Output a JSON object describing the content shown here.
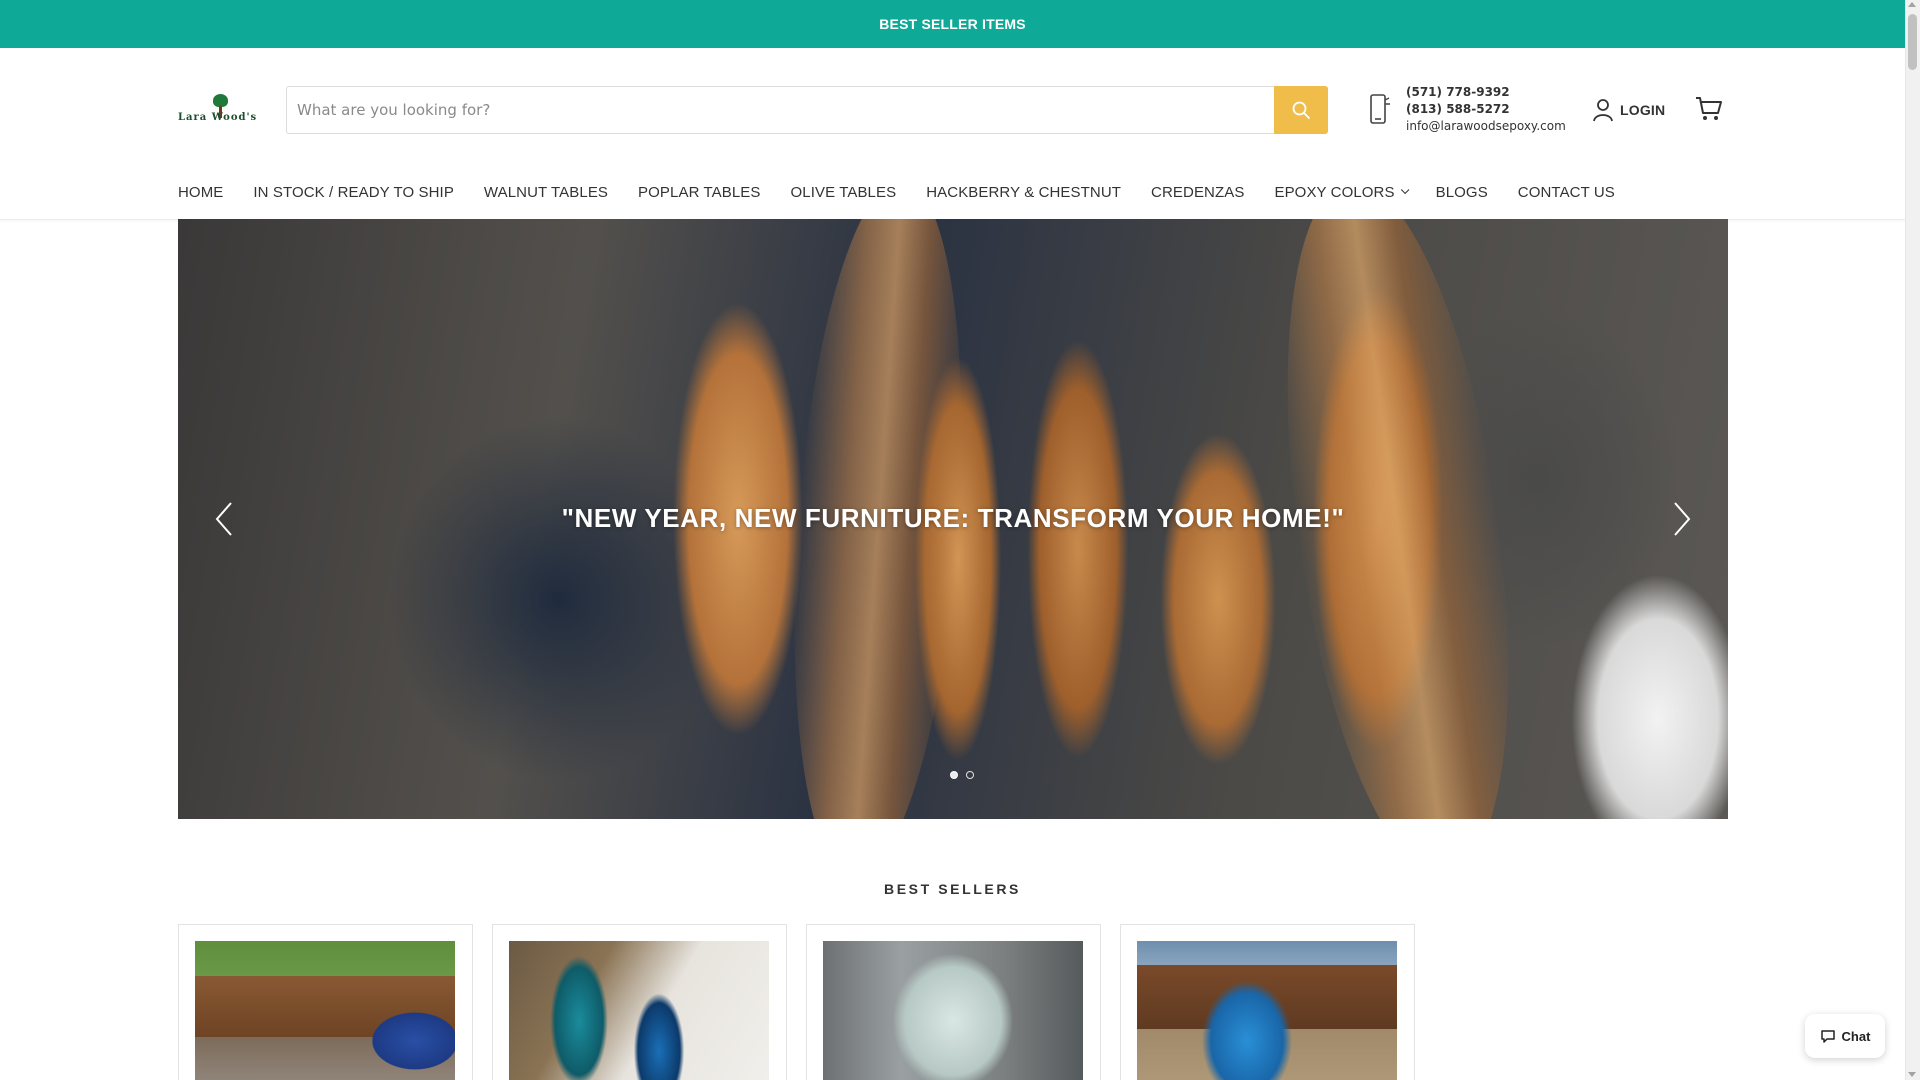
{
  "announcement": {
    "text": "BEST SELLER ITEMS"
  },
  "logo": {
    "brand": "Lara Wood's"
  },
  "search": {
    "placeholder": "What are you looking for?"
  },
  "contact": {
    "phone_1": "(571) 778-9392",
    "phone_2": "(813) 588-5272",
    "email": "info@larawoodsepoxy.com"
  },
  "account": {
    "login_label": "LOGIN"
  },
  "nav": {
    "items": [
      {
        "label": "HOME"
      },
      {
        "label": "IN STOCK / READY TO SHIP"
      },
      {
        "label": "WALNUT TABLES"
      },
      {
        "label": "POPLAR TABLES"
      },
      {
        "label": "OLIVE TABLES"
      },
      {
        "label": "HACKBERRY & CHESTNUT"
      },
      {
        "label": "CREDENZAS"
      },
      {
        "label": "EPOXY COLORS"
      },
      {
        "label": "BLOGS"
      },
      {
        "label": "CONTACT US"
      }
    ]
  },
  "hero": {
    "title": "\"NEW YEAR, NEW FURNITURE: TRANSFORM YOUR HOME!\"",
    "active_slide": 1,
    "slide_count": 2
  },
  "best_sellers": {
    "title": "BEST SELLERS"
  },
  "chat": {
    "label": "Chat"
  },
  "colors": {
    "announcement_bg": "#0fa997",
    "search_button": "#f0bd4a",
    "text": "#333333"
  },
  "icons": [
    "search-icon",
    "phone-icon",
    "user-icon",
    "cart-icon",
    "chevron-left-icon",
    "chevron-right-icon",
    "chat-icon",
    "chevron-down-icon"
  ]
}
